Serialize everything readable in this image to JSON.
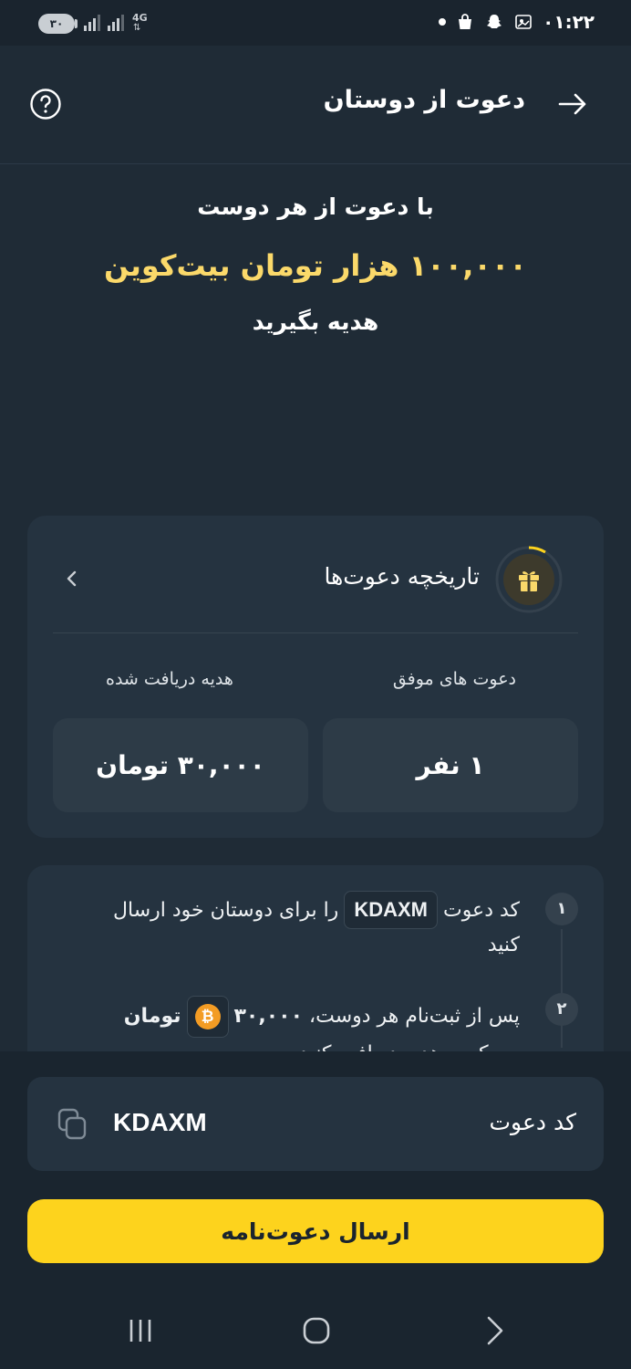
{
  "status_bar": {
    "battery": "۳۰",
    "network": "4G",
    "network_arrows": "⇅",
    "time": "۰۱:۲۲"
  },
  "header": {
    "title": "دعوت از دوستان",
    "back_icon": "arrow-right-icon",
    "help_icon": "question-circle-icon"
  },
  "hero": {
    "line1": "با دعوت از هر دوست",
    "line2": "۱۰۰,۰۰۰ هزار تومان بیت‌کوین",
    "line3": "هدیه بگیرید",
    "accent_color": "#fbd96a"
  },
  "history": {
    "title": "تاریخچه دعوت‌ها",
    "icon": "gift-icon",
    "successful_label": "دعوت های موفق",
    "successful_value": "۱ نفر",
    "received_label": "هدیه دریافت شده",
    "received_value": "۳۰,۰۰۰ تومان"
  },
  "steps": [
    {
      "number": "۱",
      "before": "کد دعوت",
      "code": "KDAXM",
      "after": "را برای دوستان خود ارسال کنید"
    },
    {
      "number": "۲",
      "before": "پس از ثبت‌نام هر دوست،",
      "amount": "۳۰,۰۰۰",
      "coin_symbol": "₿",
      "unit": "تومان",
      "after": "بیت‌کوین هدیه دریافت کنید"
    }
  ],
  "invite_code": {
    "label": "کد دعوت",
    "value": "KDAXM",
    "copy_icon": "copy-icon"
  },
  "send_button": {
    "label": "ارسال دعوت‌نامه",
    "color": "#fdd31d"
  },
  "nav": {
    "recents": "recents-icon",
    "home": "home-icon",
    "back": "back-chevron-icon"
  }
}
